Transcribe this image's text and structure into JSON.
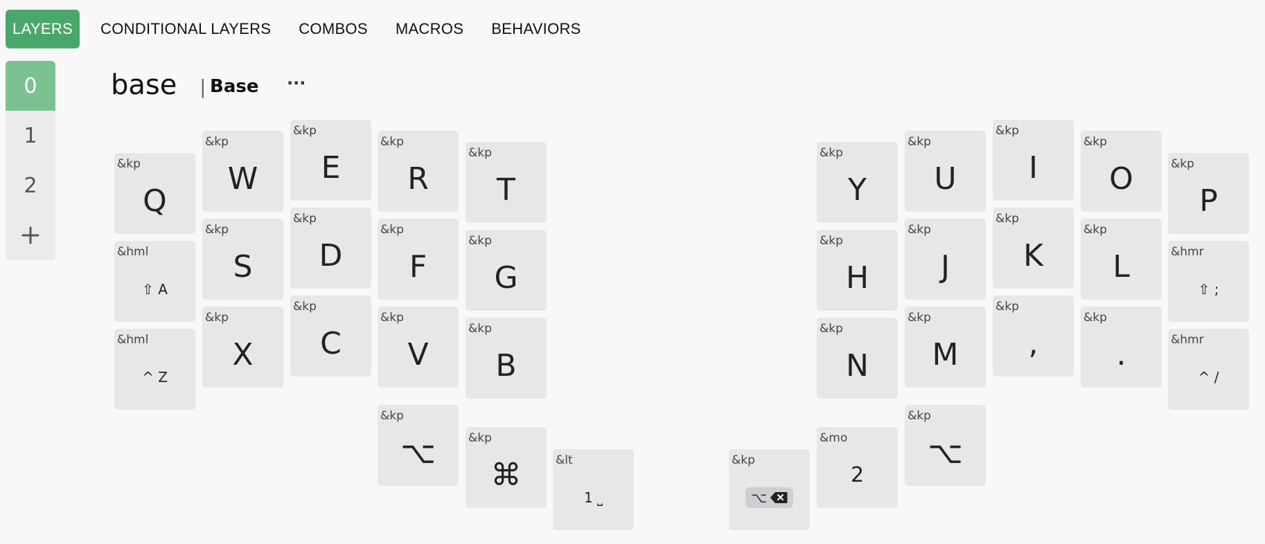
{
  "nav": {
    "tabs": [
      {
        "label": "LAYERS",
        "active": true
      },
      {
        "label": "CONDITIONAL LAYERS"
      },
      {
        "label": "COMBOS"
      },
      {
        "label": "MACROS"
      },
      {
        "label": "BEHAVIORS"
      }
    ]
  },
  "layers": {
    "items": [
      {
        "label": "0",
        "active": true
      },
      {
        "label": "1"
      },
      {
        "label": "2"
      }
    ],
    "add_icon": "plus-icon"
  },
  "heading": {
    "name": "base",
    "separator": "|",
    "label": "Base",
    "more": "···"
  },
  "keys": {
    "q": {
      "behavior": "&kp",
      "label": "Q"
    },
    "w": {
      "behavior": "&kp",
      "label": "W"
    },
    "e": {
      "behavior": "&kp",
      "label": "E"
    },
    "r": {
      "behavior": "&kp",
      "label": "R"
    },
    "t": {
      "behavior": "&kp",
      "label": "T"
    },
    "a": {
      "behavior": "&hml",
      "mod": "⇧",
      "label": "A"
    },
    "s": {
      "behavior": "&kp",
      "label": "S"
    },
    "d": {
      "behavior": "&kp",
      "label": "D"
    },
    "f": {
      "behavior": "&kp",
      "label": "F"
    },
    "g": {
      "behavior": "&kp",
      "label": "G"
    },
    "z": {
      "behavior": "&hml",
      "mod": "^",
      "label": "Z"
    },
    "x": {
      "behavior": "&kp",
      "label": "X"
    },
    "c": {
      "behavior": "&kp",
      "label": "C"
    },
    "v": {
      "behavior": "&kp",
      "label": "V"
    },
    "b": {
      "behavior": "&kp",
      "label": "B"
    },
    "lalt": {
      "behavior": "&kp",
      "label": "⌥"
    },
    "lcmd": {
      "behavior": "&kp",
      "label": "⌘"
    },
    "lspace": {
      "behavior": "&lt",
      "layer": "1",
      "label": "⎵"
    },
    "y": {
      "behavior": "&kp",
      "label": "Y"
    },
    "u": {
      "behavior": "&kp",
      "label": "U"
    },
    "i": {
      "behavior": "&kp",
      "label": "I"
    },
    "o": {
      "behavior": "&kp",
      "label": "O"
    },
    "p": {
      "behavior": "&kp",
      "label": "P"
    },
    "h": {
      "behavior": "&kp",
      "label": "H"
    },
    "j": {
      "behavior": "&kp",
      "label": "J"
    },
    "k": {
      "behavior": "&kp",
      "label": "K"
    },
    "l": {
      "behavior": "&kp",
      "label": "L"
    },
    "semi": {
      "behavior": "&hmr",
      "mod": "⇧",
      "label": ";"
    },
    "n": {
      "behavior": "&kp",
      "label": "N"
    },
    "m": {
      "behavior": "&kp",
      "label": "M"
    },
    "comma": {
      "behavior": "&kp",
      "label": ","
    },
    "dot": {
      "behavior": "&kp",
      "label": "."
    },
    "slash": {
      "behavior": "&hmr",
      "mod": "^",
      "label": "/"
    },
    "altbs": {
      "behavior": "&kp",
      "mod": "⌥",
      "icon": "backspace-icon"
    },
    "mo2": {
      "behavior": "&mo",
      "label": "2"
    },
    "ralt": {
      "behavior": "&kp",
      "label": "⌥"
    }
  },
  "colors": {
    "accent": "#4aa76a",
    "accent_light": "#7cc190",
    "key_bg": "#e7e7ea",
    "page_bg": "#f8f8f8"
  }
}
